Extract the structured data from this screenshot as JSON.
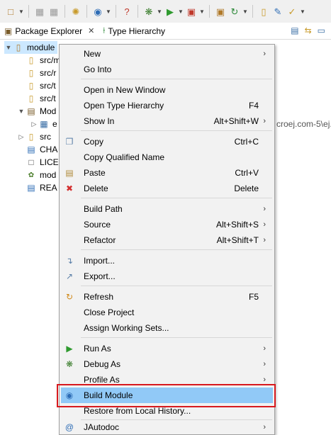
{
  "toolbar": {
    "icons": [
      "new-icon",
      "save-icon",
      "save-all-icon",
      "open-perspective-icon",
      "search-icon",
      "help-icon",
      "debug-icon",
      "run-icon",
      "external-tools-icon",
      "new-package-icon",
      "refresh-icon",
      "open-folder-icon",
      "edit-icon",
      "tool-icon"
    ]
  },
  "tabs": {
    "package_explorer": "Package Explorer",
    "type_hierarchy": "Type Hierarchy"
  },
  "tree": {
    "items": [
      {
        "label": "module",
        "icon": "project-icon",
        "expanded": true
      },
      {
        "label": "src/m",
        "icon": "source-folder-icon"
      },
      {
        "label": "src/r",
        "icon": "source-folder-icon"
      },
      {
        "label": "src/t",
        "icon": "source-folder-icon"
      },
      {
        "label": "src/t",
        "icon": "source-folder-icon"
      },
      {
        "label": "Mod",
        "icon": "library-icon",
        "expanded": true
      },
      {
        "label": "e",
        "icon": "jar-icon"
      },
      {
        "label": "src",
        "icon": "folder-icon"
      },
      {
        "label": "CHA",
        "icon": "file-icon"
      },
      {
        "label": "LICE",
        "icon": "file-icon"
      },
      {
        "label": "mod",
        "icon": "ivy-icon"
      },
      {
        "label": "REA",
        "icon": "file-icon"
      }
    ],
    "path_fragment": "croej.com-5\\ej."
  },
  "menu": {
    "items": [
      {
        "label": "New",
        "shortcut": "",
        "submenu": true,
        "icon": ""
      },
      {
        "label": "Go Into",
        "shortcut": "",
        "submenu": false,
        "icon": ""
      },
      {
        "label": "Open in New Window",
        "shortcut": "",
        "submenu": false,
        "icon": ""
      },
      {
        "label": "Open Type Hierarchy",
        "shortcut": "F4",
        "submenu": false,
        "icon": ""
      },
      {
        "label": "Show In",
        "shortcut": "Alt+Shift+W",
        "submenu": true,
        "icon": ""
      },
      {
        "label": "Copy",
        "shortcut": "Ctrl+C",
        "submenu": false,
        "icon": "copy-icon"
      },
      {
        "label": "Copy Qualified Name",
        "shortcut": "",
        "submenu": false,
        "icon": ""
      },
      {
        "label": "Paste",
        "shortcut": "Ctrl+V",
        "submenu": false,
        "icon": "paste-icon"
      },
      {
        "label": "Delete",
        "shortcut": "Delete",
        "submenu": false,
        "icon": "delete-icon"
      },
      {
        "label": "Build Path",
        "shortcut": "",
        "submenu": true,
        "icon": ""
      },
      {
        "label": "Source",
        "shortcut": "Alt+Shift+S",
        "submenu": true,
        "icon": ""
      },
      {
        "label": "Refactor",
        "shortcut": "Alt+Shift+T",
        "submenu": true,
        "icon": ""
      },
      {
        "label": "Import...",
        "shortcut": "",
        "submenu": false,
        "icon": "import-icon"
      },
      {
        "label": "Export...",
        "shortcut": "",
        "submenu": false,
        "icon": "export-icon"
      },
      {
        "label": "Refresh",
        "shortcut": "F5",
        "submenu": false,
        "icon": "refresh-icon"
      },
      {
        "label": "Close Project",
        "shortcut": "",
        "submenu": false,
        "icon": ""
      },
      {
        "label": "Assign Working Sets...",
        "shortcut": "",
        "submenu": false,
        "icon": ""
      },
      {
        "label": "Run As",
        "shortcut": "",
        "submenu": true,
        "icon": "run-icon"
      },
      {
        "label": "Debug As",
        "shortcut": "",
        "submenu": true,
        "icon": "debug-icon"
      },
      {
        "label": "Profile As",
        "shortcut": "",
        "submenu": true,
        "icon": ""
      },
      {
        "label": "Build Module",
        "shortcut": "",
        "submenu": false,
        "icon": "build-module-icon"
      },
      {
        "label": "Restore from Local History...",
        "shortcut": "",
        "submenu": false,
        "icon": ""
      },
      {
        "label": "JAutodoc",
        "shortcut": "",
        "submenu": true,
        "icon": "jautodoc-icon"
      }
    ],
    "highlighted": "Build Module"
  },
  "colors": {
    "highlight": "#91c9f7",
    "callout": "#d7191e",
    "menu_bg": "#f2f2f2"
  }
}
